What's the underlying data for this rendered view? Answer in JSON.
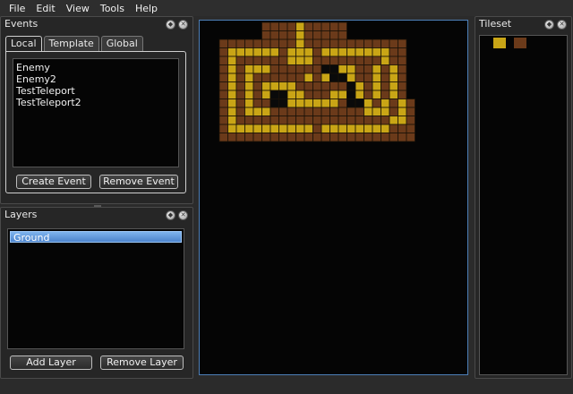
{
  "menu": [
    "File",
    "Edit",
    "View",
    "Tools",
    "Help"
  ],
  "events_panel": {
    "title": "Events",
    "tabs": [
      "Local",
      "Template",
      "Global"
    ],
    "active_tab": "Local",
    "items": [
      "Enemy",
      "Enemy2",
      "TestTeleport",
      "TestTeleport2"
    ],
    "create_label": "Create Event",
    "remove_label": "Remove Event"
  },
  "layers_panel": {
    "title": "Layers",
    "items": [
      "Ground"
    ],
    "selected": "Ground",
    "add_label": "Add Layer",
    "remove_label": "Remove Layer"
  },
  "tileset_panel": {
    "title": "Tileset",
    "tiles": [
      "yellow-tile",
      "brown-tile"
    ]
  },
  "map": {
    "legend": {
      ".": "yellow",
      "b": "brown",
      "d": "dark",
      " ": "empty"
    },
    "rows": [
      "     bbbb.bbbbb      ",
      "     bbbb.bbbbb      ",
      "bbbbbbbbb.bbbbbbbbbbbb",
      "b......b...b........bb",
      "b.bbbbbb...bbbbbbbb.bb",
      "b.b...bbbbbbdd..bb.b.b",
      "b.b.bbbbbb.b.dd.bb.b.b",
      "b.b.b....bbbbbbd.b.b.b",
      "b.b.b.dd..bbb..d.b.b.b",
      "b.b.bbdd......bdd.b.b.b",
      "b.b...bbbbbbbbbbb...b.b",
      "b.bbbbbbbbbbbbbbbbbb..b",
      "b..........b........bbb",
      "bbbbbbbbbbbbbbbbbbbbbbb"
    ],
    "colors": {
      "yellow": "#c9a516",
      "brown": "#6b3a1a",
      "dark": "#0a0a0a",
      "grid": "#1a1208"
    }
  },
  "icons": {
    "close": "close-icon",
    "float": "float-icon"
  }
}
